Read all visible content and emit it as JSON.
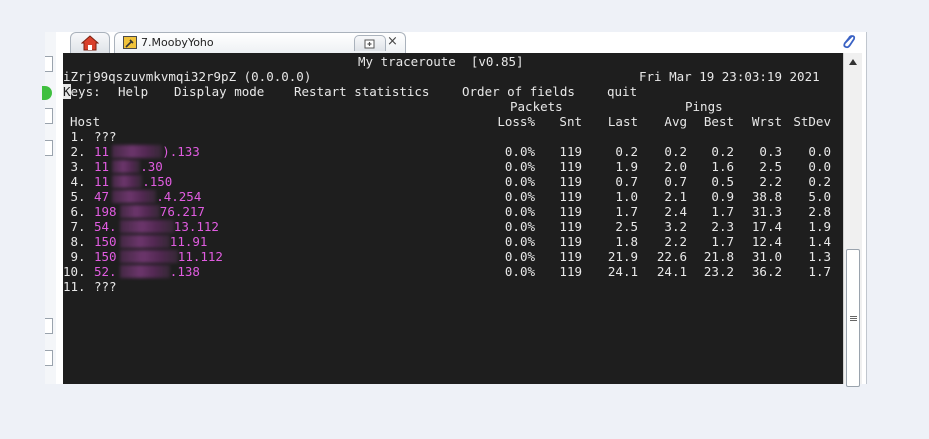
{
  "browser": {
    "tab_title": "7.MoobyYoho",
    "close_glyph": "×",
    "home_icon": "home-icon",
    "new_tab_icon": "new-tab-icon",
    "attach_icon": "paperclip-icon",
    "accent": "#f0c23a"
  },
  "terminal": {
    "title": "My traceroute  [v0.85]",
    "hostname": "iZrj99qszuvmkvmqi32r9pZ (0.0.0.0)",
    "datetime": "Fri Mar 19 23:03:19 2021",
    "keys_label_first": "K",
    "keys_label_rest": "eys:",
    "menu": [
      "Help",
      "Display mode",
      "Restart statistics",
      "Order of fields",
      "quit"
    ],
    "group_packets": "Packets",
    "group_pings": "Pings",
    "columns": {
      "host": "Host",
      "loss": "Loss%",
      "snt": "Snt",
      "last": "Last",
      "avg": "Avg",
      "best": "Best",
      "wrst": "Wrst",
      "stdev": "StDev"
    },
    "rows": [
      {
        "num": " 1.",
        "pre": "???",
        "post": "",
        "stats": null
      },
      {
        "num": " 2.",
        "pre": "11",
        "post": ").133",
        "stats": [
          "0.0%",
          "119",
          "0.2",
          "0.2",
          "0.2",
          "0.3",
          "0.0"
        ]
      },
      {
        "num": " 3.",
        "pre": "11",
        "post": ".30",
        "stats": [
          "0.0%",
          "119",
          "1.9",
          "2.0",
          "1.6",
          "2.5",
          "0.0"
        ]
      },
      {
        "num": " 4.",
        "pre": "11",
        "post": ".150",
        "stats": [
          "0.0%",
          "119",
          "0.7",
          "0.7",
          "0.5",
          "2.2",
          "0.2"
        ]
      },
      {
        "num": " 5.",
        "pre": "47",
        "post": ".4.254",
        "stats": [
          "0.0%",
          "119",
          "1.0",
          "2.1",
          "0.9",
          "38.8",
          "5.0"
        ]
      },
      {
        "num": " 6.",
        "pre": "198",
        "post": "76.217",
        "stats": [
          "0.0%",
          "119",
          "1.7",
          "2.4",
          "1.7",
          "31.3",
          "2.8"
        ]
      },
      {
        "num": " 7.",
        "pre": "54.",
        "post": "13.112",
        "stats": [
          "0.0%",
          "119",
          "2.5",
          "3.2",
          "2.3",
          "17.4",
          "1.9"
        ]
      },
      {
        "num": " 8.",
        "pre": "150",
        "post": "11.91",
        "stats": [
          "0.0%",
          "119",
          "1.8",
          "2.2",
          "1.7",
          "12.4",
          "1.4"
        ]
      },
      {
        "num": " 9.",
        "pre": "150",
        "post": "11.112",
        "stats": [
          "0.0%",
          "119",
          "21.9",
          "22.6",
          "21.8",
          "31.0",
          "1.3"
        ]
      },
      {
        "num": "10.",
        "pre": "52.",
        "post": ".138",
        "stats": [
          "0.0%",
          "119",
          "24.1",
          "24.1",
          "23.2",
          "36.2",
          "1.7"
        ]
      },
      {
        "num": "11.",
        "pre": "???",
        "post": "",
        "stats": null
      }
    ],
    "host_color": "#e05ce0",
    "bg": "#1e1e1e",
    "fg": "#e8e8e8"
  }
}
